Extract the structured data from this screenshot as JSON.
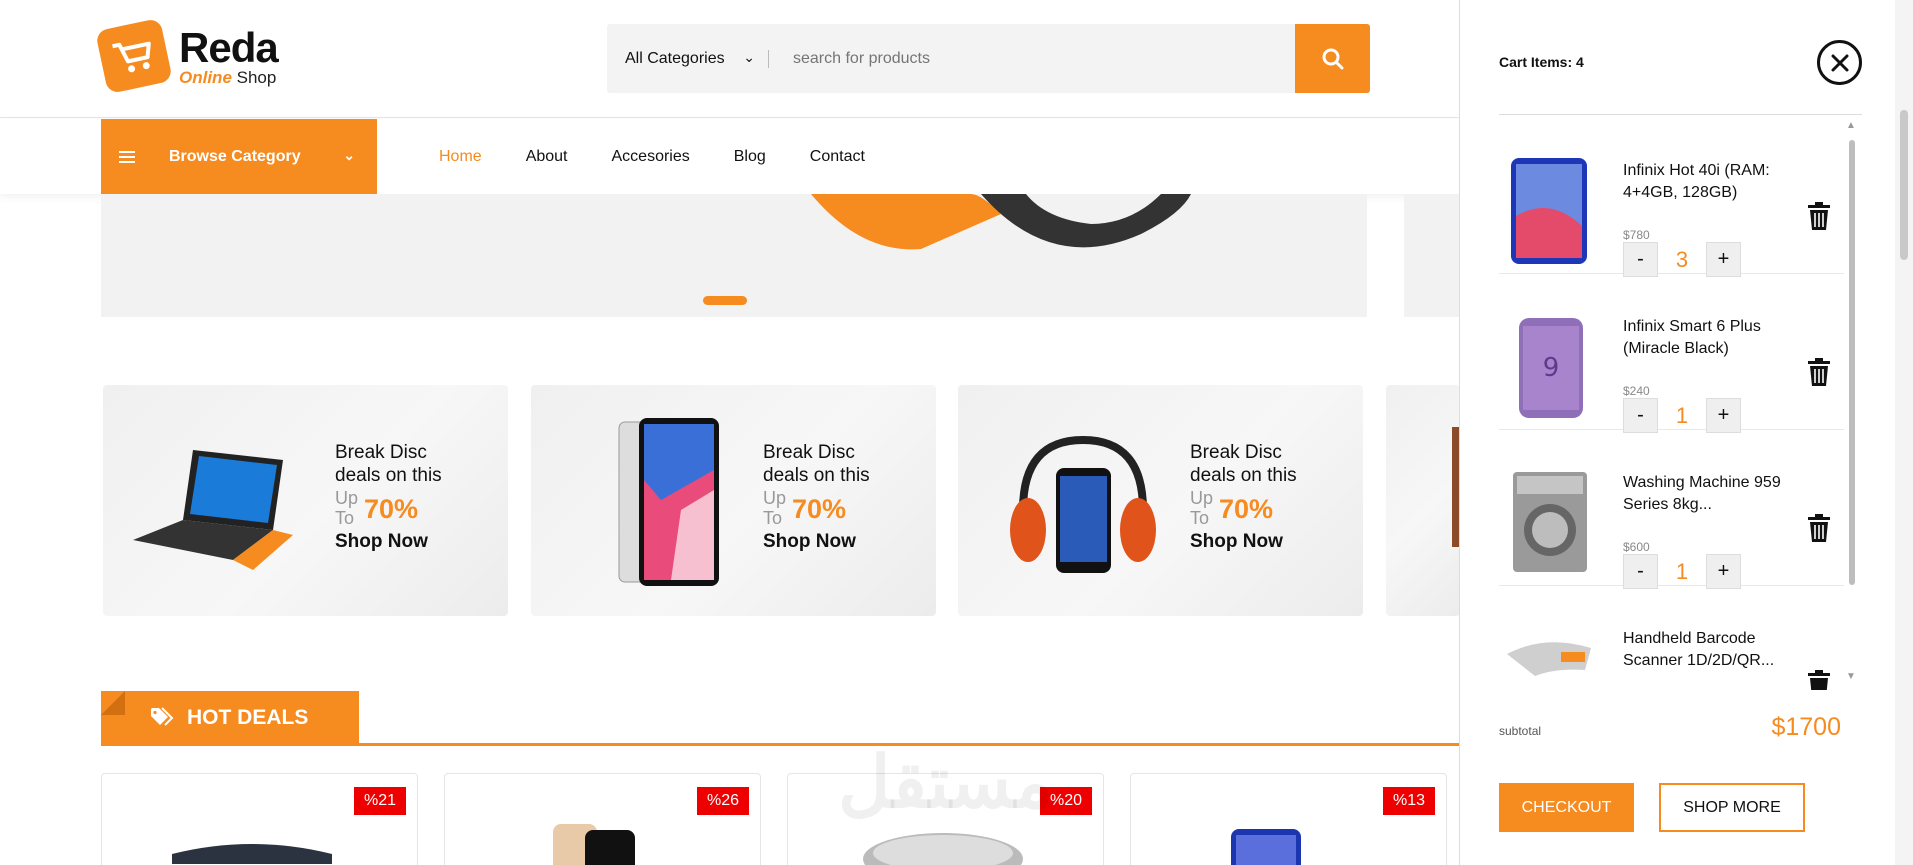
{
  "brand": {
    "name": "Reda",
    "sub_highlight": "Online",
    "sub_rest": "Shop"
  },
  "search": {
    "category": "All Categories",
    "placeholder": "search for products"
  },
  "nav": {
    "browse_label": "Browse Category",
    "links": [
      "Home",
      "About",
      "Accesories",
      "Blog",
      "Contact"
    ],
    "active": "Home"
  },
  "promos": [
    {
      "line1": "Break Disc",
      "line2": "deals on this",
      "up": "Up",
      "to": "To",
      "percent": "70%",
      "cta": "Shop Now"
    },
    {
      "line1": "Break Disc",
      "line2": "deals on this",
      "up": "Up",
      "to": "To",
      "percent": "70%",
      "cta": "Shop Now"
    },
    {
      "line1": "Break Disc",
      "line2": "deals on this",
      "up": "Up",
      "to": "To",
      "percent": "70%",
      "cta": "Shop Now"
    }
  ],
  "hot_deals": {
    "title": "HOT DEALS",
    "badges": [
      "%21",
      "%26",
      "%20",
      "%13"
    ]
  },
  "cart": {
    "title": "Cart Items: 4",
    "items": [
      {
        "name": "Infinix Hot 40i (RAM: 4+4GB, 128GB)",
        "price": "$780",
        "qty": "3"
      },
      {
        "name": "Infinix Smart 6 Plus (Miracle Black)",
        "price": "$240",
        "qty": "1"
      },
      {
        "name": "Washing Machine 959 Series 8kg...",
        "price": "$600",
        "qty": "1"
      },
      {
        "name": "Handheld Barcode Scanner 1D/2D/QR...",
        "price": "",
        "qty": ""
      }
    ],
    "minus": "-",
    "plus": "+",
    "subtotal_label": "subtotal",
    "subtotal_value": "$1700",
    "checkout": "CHECKOUT",
    "shop_more": "SHOP MORE"
  },
  "colors": {
    "accent": "#f68b1f",
    "badge": "#ee0000"
  },
  "icons": [
    "cart-logo-icon",
    "search-icon",
    "hamburger-icon",
    "chevron-down-icon",
    "tag-icon",
    "close-icon",
    "trash-icon"
  ]
}
